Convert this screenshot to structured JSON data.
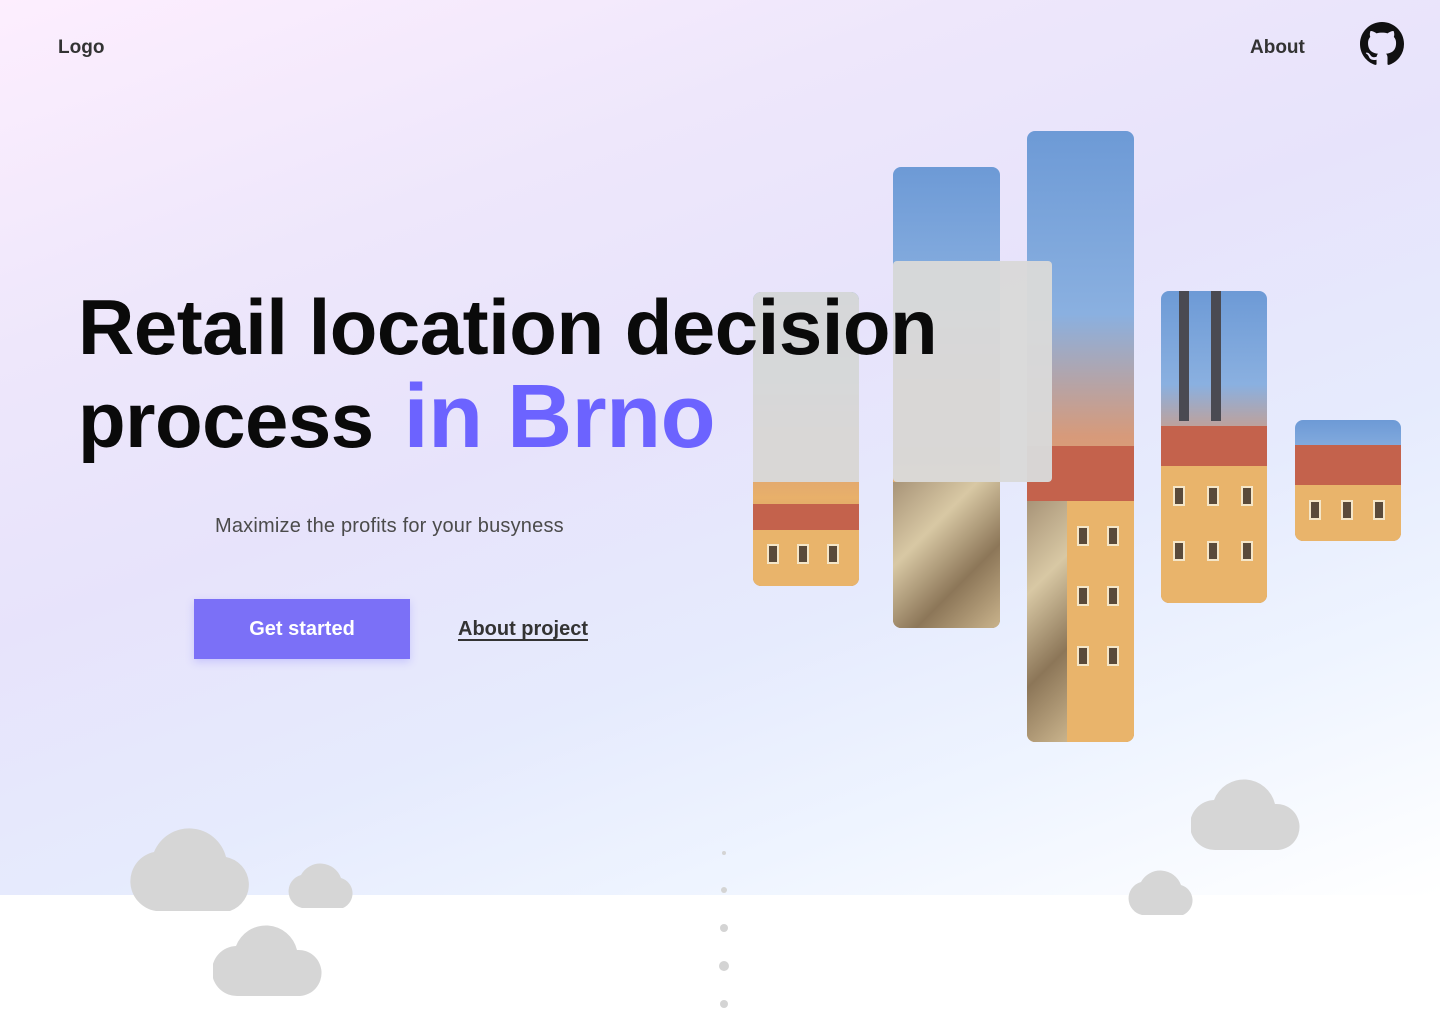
{
  "header": {
    "logo": "Logo",
    "nav_about": "About",
    "github_icon": "github-icon"
  },
  "hero": {
    "headline_line1": "Retail location decision",
    "headline_line2": "process",
    "headline_accent": "in Brno",
    "subtitle": "Maximize the profits for your busyness",
    "cta_primary": "Get started",
    "cta_secondary": "About project"
  },
  "colors": {
    "accent": "#6c63ff",
    "button": "#7b70f7",
    "placeholder_gray": "#d9d9d9"
  },
  "decor": {
    "photo_strips": 5,
    "clouds": 5,
    "scroll_dots": 5
  }
}
